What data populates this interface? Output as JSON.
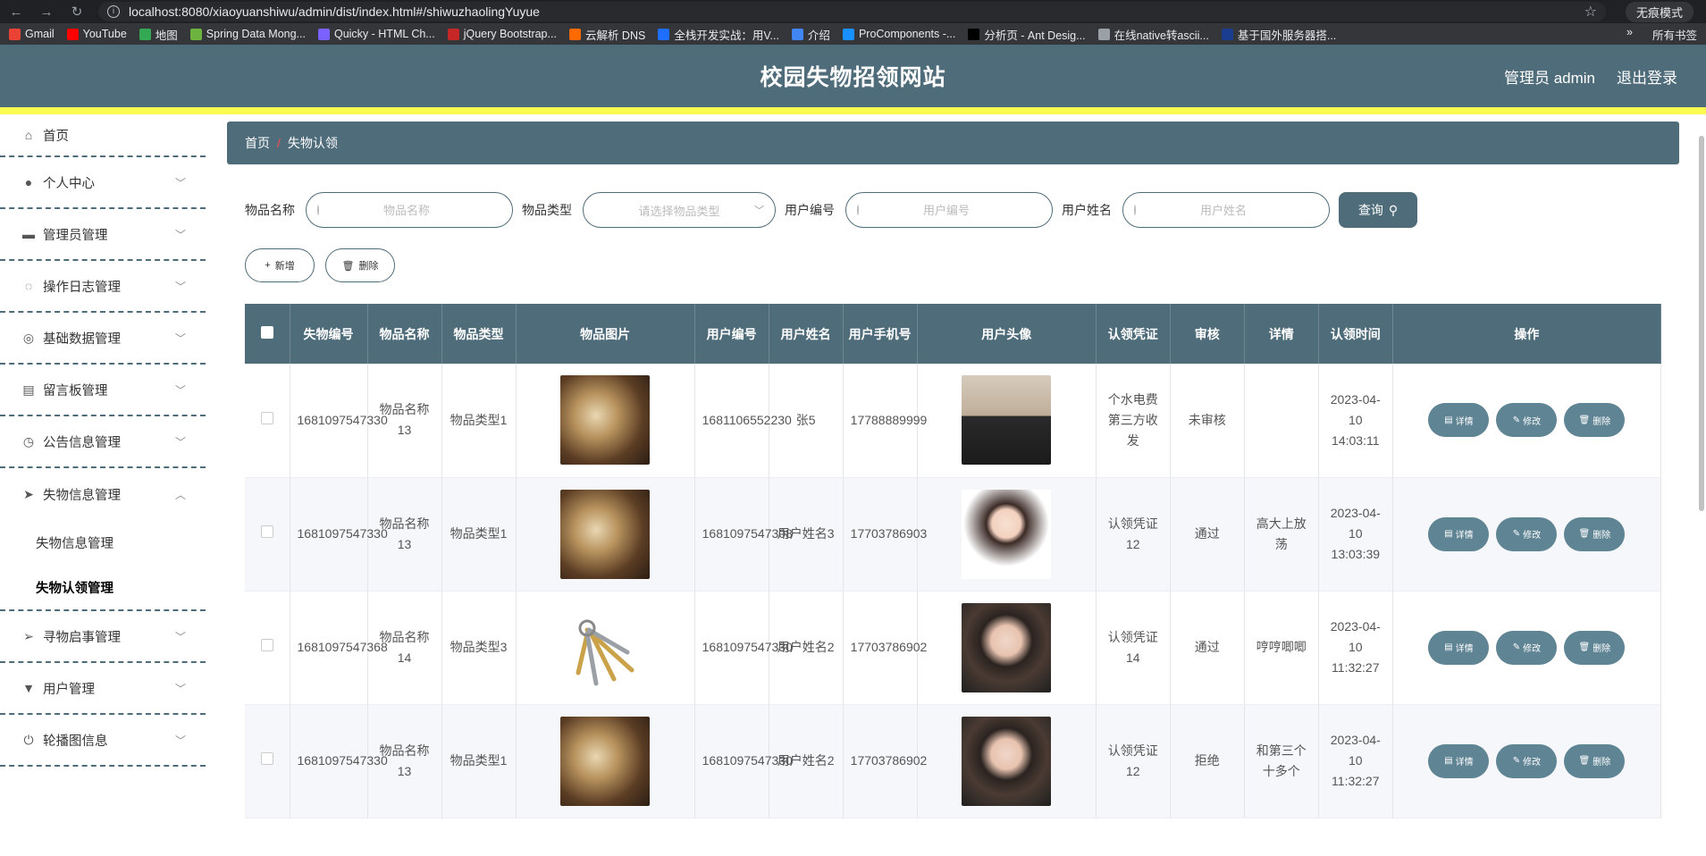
{
  "browser": {
    "url": "localhost:8080/xiaoyuanshiwu/admin/dist/index.html#/shiwuzhaolingYuyue",
    "incognito_label": "无痕模式",
    "bookmarks": [
      {
        "label": "Gmail",
        "color": "#ea4335"
      },
      {
        "label": "YouTube",
        "color": "#ff0000"
      },
      {
        "label": "地图",
        "color": "#34a853"
      },
      {
        "label": "Spring Data Mong...",
        "color": "#6db33f"
      },
      {
        "label": "Quicky - HTML Ch...",
        "color": "#7b61ff"
      },
      {
        "label": "jQuery Bootstrap...",
        "color": "#c62828"
      },
      {
        "label": "云解析 DNS",
        "color": "#ff6a00"
      },
      {
        "label": "全栈开发实战：用V...",
        "color": "#1e6fff"
      },
      {
        "label": "介绍",
        "color": "#4285f4"
      },
      {
        "label": "ProComponents -...",
        "color": "#1890ff"
      },
      {
        "label": "分析页 - Ant Desig...",
        "color": "#000000"
      },
      {
        "label": "在线native转ascii...",
        "color": "#9aa0a6"
      },
      {
        "label": "基于国外服务器搭...",
        "color": "#1a3d8f"
      }
    ],
    "more": "»",
    "all_bookmarks": "所有书签"
  },
  "header": {
    "title": "校园失物招领网站",
    "user": "管理员 admin",
    "logout": "退出登录"
  },
  "sidebar": {
    "items": [
      {
        "label": "首页",
        "icon": "home-icon",
        "glyph": "⌂"
      },
      {
        "label": "个人中心",
        "icon": "user-icon",
        "glyph": "●"
      },
      {
        "label": "管理员管理",
        "icon": "admin-icon",
        "glyph": "▬"
      },
      {
        "label": "操作日志管理",
        "icon": "bell-off-icon",
        "glyph": "◌"
      },
      {
        "label": "基础数据管理",
        "icon": "data-icon",
        "glyph": "◎"
      },
      {
        "label": "留言板管理",
        "icon": "clipboard-icon",
        "glyph": "▤"
      },
      {
        "label": "公告信息管理",
        "icon": "clock-icon",
        "glyph": "◷"
      },
      {
        "label": "失物信息管理",
        "icon": "send-icon",
        "glyph": "➤"
      },
      {
        "label": "寻物启事管理",
        "icon": "send-outline-icon",
        "glyph": "➢"
      },
      {
        "label": "用户管理",
        "icon": "tag-icon",
        "glyph": "▼"
      },
      {
        "label": "轮播图信息",
        "icon": "power-icon",
        "glyph": "⏻"
      }
    ],
    "submenu": [
      "失物信息管理",
      "失物认领管理"
    ]
  },
  "breadcrumb": {
    "home": "首页",
    "sep": "/",
    "current": "失物认领"
  },
  "search": {
    "fields": [
      {
        "label": "物品名称",
        "placeholder": "物品名称"
      },
      {
        "label": "物品类型",
        "placeholder": "请选择物品类型"
      },
      {
        "label": "用户编号",
        "placeholder": "用户编号"
      },
      {
        "label": "用户姓名",
        "placeholder": "用户姓名"
      }
    ],
    "button": "查询"
  },
  "actions": {
    "add": "新增",
    "delete": "删除"
  },
  "table": {
    "headers": [
      "失物编号",
      "物品名称",
      "物品类型",
      "物品图片",
      "用户编号",
      "用户姓名",
      "用户手机号",
      "用户头像",
      "认领凭证",
      "审核",
      "详情",
      "认领时间",
      "操作"
    ],
    "rows": [
      {
        "id": "1681097547330",
        "name": "物品名称13",
        "type": "物品类型1",
        "img": "book",
        "uid": "1681106552230",
        "uname": "张5",
        "phone": "17788889999",
        "avatar": "person1",
        "proof": "个水电费第三方收发",
        "status": "未审核",
        "detail": "",
        "time": "2023-04-10 14:03:11"
      },
      {
        "id": "1681097547330",
        "name": "物品名称13",
        "type": "物品类型1",
        "img": "book",
        "uid": "1681097547308",
        "uname": "用户姓名3",
        "phone": "17703786903",
        "avatar": "anime",
        "proof": "认领凭证12",
        "status": "通过",
        "detail": "高大上放荡",
        "time": "2023-04-10 13:03:39"
      },
      {
        "id": "1681097547368",
        "name": "物品名称14",
        "type": "物品类型3",
        "img": "keys",
        "uid": "1681097547330",
        "uname": "用户姓名2",
        "phone": "17703786902",
        "avatar": "girl",
        "proof": "认领凭证14",
        "status": "通过",
        "detail": "哼哼唧唧",
        "time": "2023-04-10 11:32:27"
      },
      {
        "id": "1681097547330",
        "name": "物品名称13",
        "type": "物品类型1",
        "img": "book",
        "uid": "1681097547330",
        "uname": "用户姓名2",
        "phone": "17703786902",
        "avatar": "girl",
        "proof": "认领凭证12",
        "status": "拒绝",
        "detail": "和第三个十多个",
        "time": "2023-04-10 11:32:27"
      }
    ],
    "op_labels": {
      "detail": "详情",
      "edit": "修改",
      "delete": "删除"
    }
  }
}
